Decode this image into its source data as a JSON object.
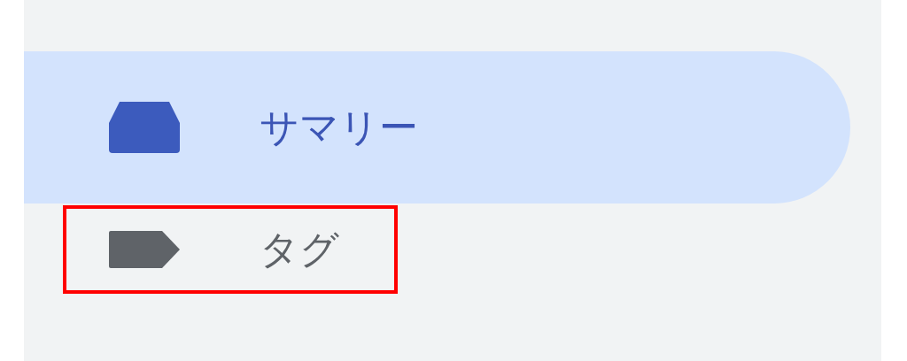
{
  "nav_items": [
    {
      "label": "サマリー",
      "kind": "tray",
      "selected": true,
      "highlighted": false
    },
    {
      "label": "タグ",
      "kind": "tag",
      "selected": false,
      "highlighted": true
    }
  ]
}
